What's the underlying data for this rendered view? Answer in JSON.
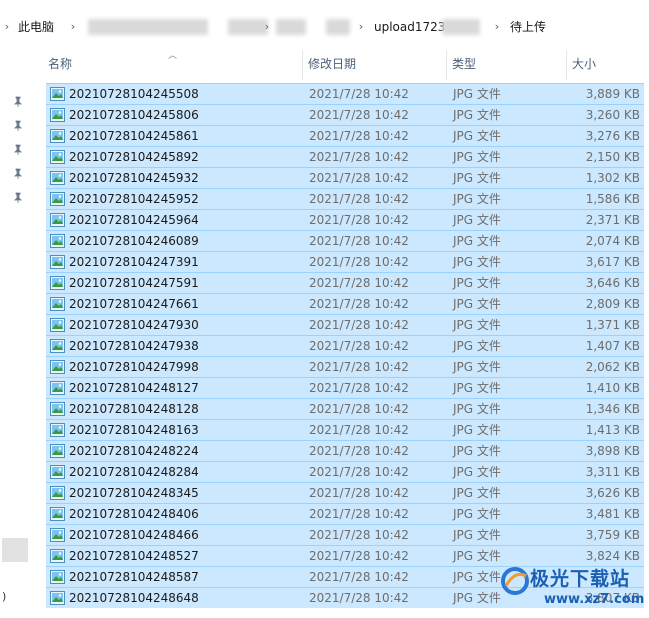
{
  "breadcrumb": {
    "items": [
      "此电脑",
      "upload1723",
      "待上传"
    ]
  },
  "columns": {
    "name": "名称",
    "date": "修改日期",
    "type": "类型",
    "size": "大小"
  },
  "files": [
    {
      "name": "20210728104245508",
      "date": "2021/7/28 10:42",
      "type": "JPG 文件",
      "size": "3,889 KB"
    },
    {
      "name": "20210728104245806",
      "date": "2021/7/28 10:42",
      "type": "JPG 文件",
      "size": "3,260 KB"
    },
    {
      "name": "20210728104245861",
      "date": "2021/7/28 10:42",
      "type": "JPG 文件",
      "size": "3,276 KB"
    },
    {
      "name": "20210728104245892",
      "date": "2021/7/28 10:42",
      "type": "JPG 文件",
      "size": "2,150 KB"
    },
    {
      "name": "20210728104245932",
      "date": "2021/7/28 10:42",
      "type": "JPG 文件",
      "size": "1,302 KB"
    },
    {
      "name": "20210728104245952",
      "date": "2021/7/28 10:42",
      "type": "JPG 文件",
      "size": "1,586 KB"
    },
    {
      "name": "20210728104245964",
      "date": "2021/7/28 10:42",
      "type": "JPG 文件",
      "size": "2,371 KB"
    },
    {
      "name": "20210728104246089",
      "date": "2021/7/28 10:42",
      "type": "JPG 文件",
      "size": "2,074 KB"
    },
    {
      "name": "20210728104247391",
      "date": "2021/7/28 10:42",
      "type": "JPG 文件",
      "size": "3,617 KB"
    },
    {
      "name": "20210728104247591",
      "date": "2021/7/28 10:42",
      "type": "JPG 文件",
      "size": "3,646 KB"
    },
    {
      "name": "20210728104247661",
      "date": "2021/7/28 10:42",
      "type": "JPG 文件",
      "size": "2,809 KB"
    },
    {
      "name": "20210728104247930",
      "date": "2021/7/28 10:42",
      "type": "JPG 文件",
      "size": "1,371 KB"
    },
    {
      "name": "20210728104247938",
      "date": "2021/7/28 10:42",
      "type": "JPG 文件",
      "size": "1,407 KB"
    },
    {
      "name": "20210728104247998",
      "date": "2021/7/28 10:42",
      "type": "JPG 文件",
      "size": "2,062 KB"
    },
    {
      "name": "20210728104248127",
      "date": "2021/7/28 10:42",
      "type": "JPG 文件",
      "size": "1,410 KB"
    },
    {
      "name": "20210728104248128",
      "date": "2021/7/28 10:42",
      "type": "JPG 文件",
      "size": "1,346 KB"
    },
    {
      "name": "20210728104248163",
      "date": "2021/7/28 10:42",
      "type": "JPG 文件",
      "size": "1,413 KB"
    },
    {
      "name": "20210728104248224",
      "date": "2021/7/28 10:42",
      "type": "JPG 文件",
      "size": "3,898 KB"
    },
    {
      "name": "20210728104248284",
      "date": "2021/7/28 10:42",
      "type": "JPG 文件",
      "size": "3,311 KB"
    },
    {
      "name": "20210728104248345",
      "date": "2021/7/28 10:42",
      "type": "JPG 文件",
      "size": "3,626 KB"
    },
    {
      "name": "20210728104248406",
      "date": "2021/7/28 10:42",
      "type": "JPG 文件",
      "size": "3,481 KB"
    },
    {
      "name": "20210728104248466",
      "date": "2021/7/28 10:42",
      "type": "JPG 文件",
      "size": "3,759 KB"
    },
    {
      "name": "20210728104248527",
      "date": "2021/7/28 10:42",
      "type": "JPG 文件",
      "size": "3,824 KB"
    },
    {
      "name": "20210728104248587",
      "date": "2021/7/28 10:42",
      "type": "JPG 文件",
      "size": ""
    },
    {
      "name": "20210728104248648",
      "date": "2021/7/28 10:42",
      "type": "JPG 文件",
      "size": "3,807 KB"
    }
  ],
  "nav": {
    "pins": [
      "pin-icon",
      "pin-icon",
      "pin-icon",
      "pin-icon",
      "pin-icon"
    ],
    "paren": ")"
  },
  "watermark": {
    "text": "极光下载站",
    "url": "www.xz7.com"
  },
  "colors": {
    "selection_bg": "#cce8ff",
    "selection_border": "#99d1ff",
    "header_text": "#4c607a"
  }
}
